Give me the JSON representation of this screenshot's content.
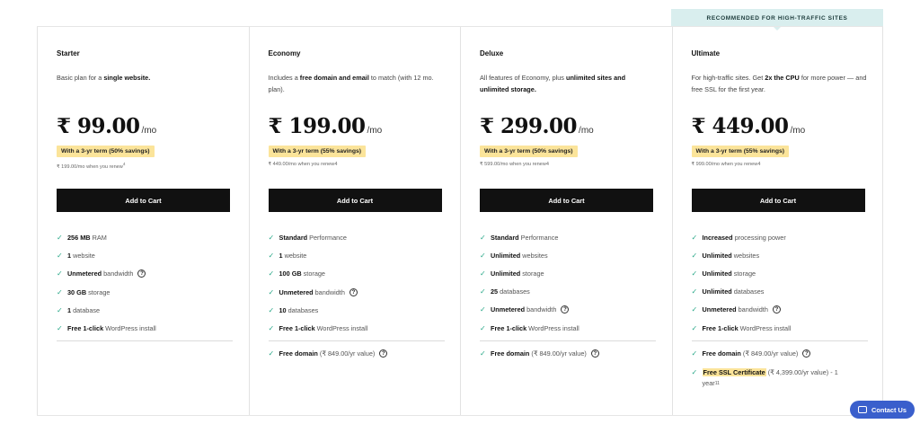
{
  "banner": "RECOMMENDED FOR HIGH-TRAFFIC SITES",
  "plans": [
    {
      "name": "Starter",
      "desc_pre": "Basic plan for a ",
      "desc_b1": "single website.",
      "desc_mid": "",
      "desc_b2": "",
      "desc_post": "",
      "price": "₹ 99.00",
      "per": "/mo",
      "savings": "With a 3-yr term (50% savings)",
      "renew": "₹ 199.00/mo when you renew",
      "renew_sup": "4",
      "cart": "Add to Cart",
      "features": [
        {
          "b": "256 MB",
          "t": "RAM"
        },
        {
          "b": "1",
          "t": "website"
        },
        {
          "b": "Unmetered",
          "t": "bandwidth"
        },
        {
          "b": "30 GB",
          "t": "storage"
        },
        {
          "b": "1",
          "t": "database"
        },
        {
          "b": "Free 1-click",
          "t": "WordPress install"
        }
      ]
    },
    {
      "name": "Economy",
      "desc_pre": "Includes a ",
      "desc_b1": "free domain and email",
      "desc_mid": " to match (with 12 mo. plan).",
      "desc_b2": "",
      "desc_post": "",
      "price": "₹ 199.00",
      "per": "/mo",
      "savings": "With a 3-yr term (55% savings)",
      "renew": "₹ 449.00/mo when you renew",
      "renew_sup": "4",
      "cart": "Add to Cart",
      "features": [
        {
          "b": "Standard",
          "t": "Performance"
        },
        {
          "b": "1",
          "t": "website"
        },
        {
          "b": "100 GB",
          "t": "storage"
        },
        {
          "b": "Unmetered",
          "t": "bandwidth"
        },
        {
          "b": "10",
          "t": "databases"
        },
        {
          "b": "Free 1-click",
          "t": "WordPress install"
        },
        {
          "b": "Free domain",
          "t": "(₹ 849.00/yr value)"
        }
      ]
    },
    {
      "name": "Deluxe",
      "desc_pre": "All features of Economy, plus ",
      "desc_b1": "unlimited sites and unlimited storage.",
      "desc_mid": "",
      "desc_b2": "",
      "desc_post": "",
      "price": "₹ 299.00",
      "per": "/mo",
      "savings": "With a 3-yr term (50% savings)",
      "renew": "₹ 599.00/mo when you renew",
      "renew_sup": "4",
      "cart": "Add to Cart",
      "features": [
        {
          "b": "Standard",
          "t": "Performance"
        },
        {
          "b": "Unlimited",
          "t": "websites"
        },
        {
          "b": "Unlimited",
          "t": "storage"
        },
        {
          "b": "25",
          "t": "databases"
        },
        {
          "b": "Unmetered",
          "t": "bandwidth"
        },
        {
          "b": "Free 1-click",
          "t": "WordPress install"
        },
        {
          "b": "Free domain",
          "t": "(₹ 849.00/yr value)"
        }
      ]
    },
    {
      "name": "Ultimate",
      "desc_pre": "For high-traffic sites. Get ",
      "desc_b1": "2x the CPU",
      "desc_mid": " for more power — and free SSL for the first year.",
      "desc_b2": "",
      "desc_post": "",
      "price": "₹ 449.00",
      "per": "/mo",
      "savings": "With a 3-yr term (55% savings)",
      "renew": "₹ 999.00/mo when you renew",
      "renew_sup": "4",
      "cart": "Add to Cart",
      "features": [
        {
          "b": "Increased",
          "t": "processing power"
        },
        {
          "b": "Unlimited",
          "t": "websites"
        },
        {
          "b": "Unlimited",
          "t": "storage"
        },
        {
          "b": "Unlimited",
          "t": "databases"
        },
        {
          "b": "Unmetered",
          "t": "bandwidth"
        },
        {
          "b": "Free 1-click",
          "t": "WordPress install"
        },
        {
          "b": "Free domain",
          "t": "(₹ 849.00/yr value)"
        },
        {
          "b": "Free SSL Certificate",
          "t": "(₹ 4,399.00/yr value) - 1"
        }
      ],
      "ssl_tail": "year",
      "ssl_sup": "11"
    }
  ],
  "contact": "Contact Us",
  "colors": {
    "check": "#27a787",
    "highlight": "#fbe49a",
    "banner": "#d9eeee",
    "contact": "#3a5fcc",
    "button": "#111111"
  }
}
